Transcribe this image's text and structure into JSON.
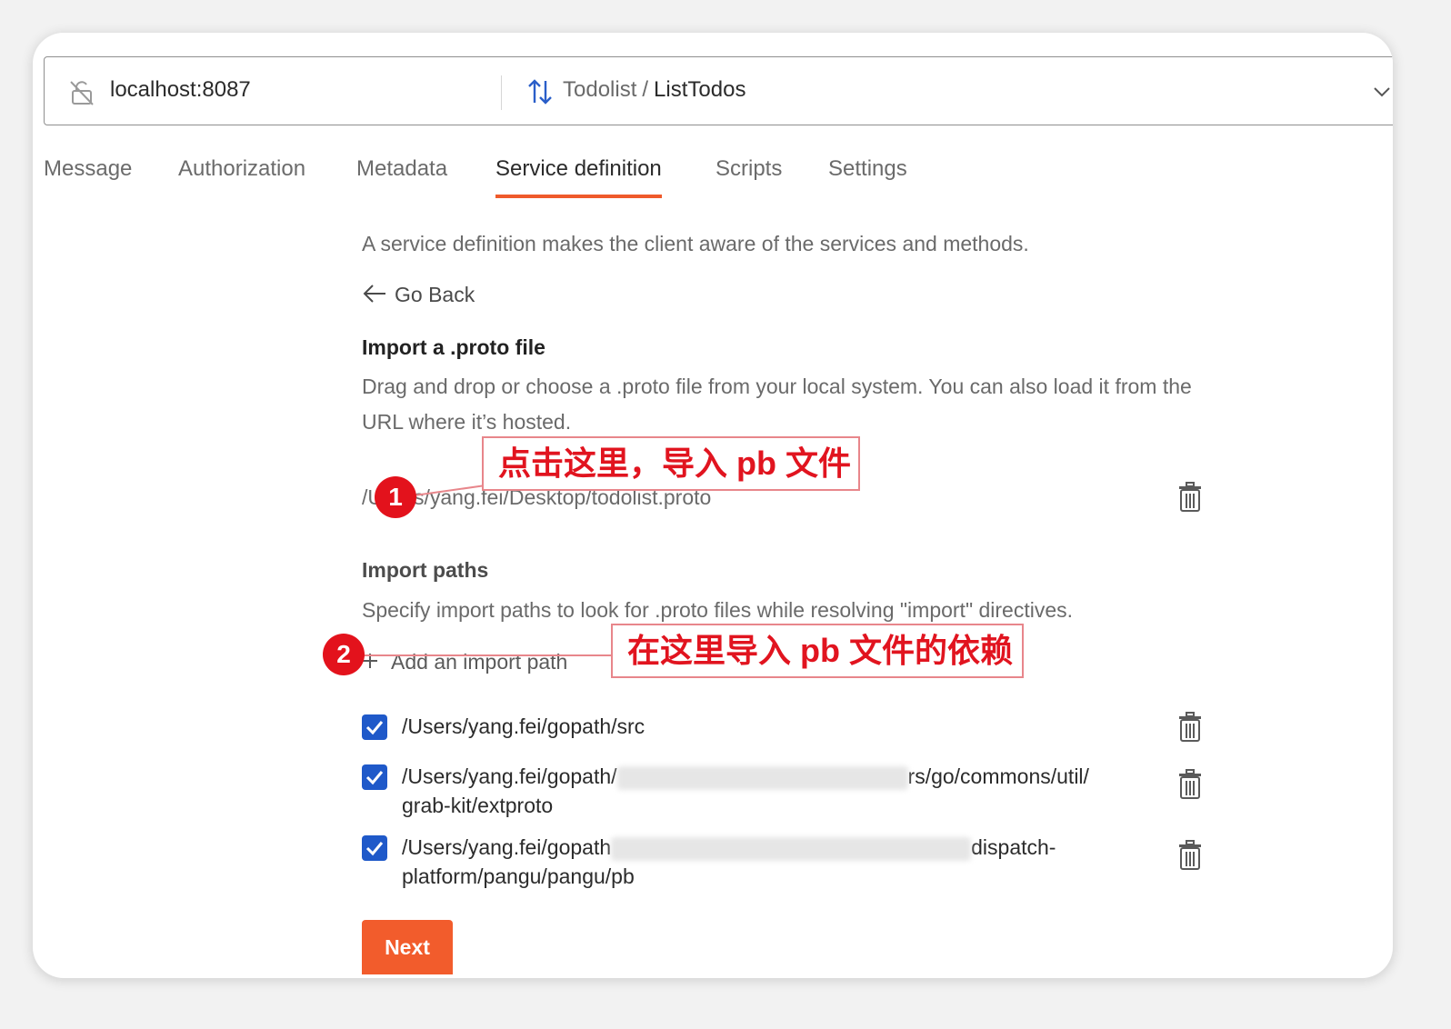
{
  "urlbar": {
    "host": "localhost:8087",
    "service": "Todolist",
    "separator": "/",
    "method": "ListTodos"
  },
  "tabs": [
    {
      "label": "Message"
    },
    {
      "label": "Authorization"
    },
    {
      "label": "Metadata"
    },
    {
      "label": "Service definition",
      "active": true
    },
    {
      "label": "Scripts"
    },
    {
      "label": "Settings"
    }
  ],
  "main": {
    "intro": "A service definition makes the client aware of the services and methods.",
    "go_back": "Go Back",
    "import_file": {
      "title": "Import a .proto file",
      "description": "Drag and drop or choose a .proto file from your local system. You can also load it from the URL where it’s hosted.",
      "path_visible": "s/yang.fei/Desktop/todolist.proto",
      "path_prefix": "/U"
    },
    "import_paths": {
      "title": "Import paths",
      "description": "Specify import paths to look for .proto files while resolving \"import\" directives.",
      "add_label": "Add an import path",
      "items": [
        {
          "checked": true,
          "text_a": "/Users/yang.fei/gopath/src",
          "text_b": ""
        },
        {
          "checked": true,
          "text_a": "/Users/yang.fei/gopath/",
          "text_b": "rs/go/commons/util/",
          "text_c": "grab-kit/extproto"
        },
        {
          "checked": true,
          "text_a": "/Users/yang.fei/gopath",
          "text_b": "dispatch-",
          "text_c": "platform/pangu/pangu/pb"
        }
      ]
    },
    "next_label": "Next"
  },
  "annotations": [
    {
      "number": "1",
      "text": "点击这里，导入 pb 文件"
    },
    {
      "number": "2",
      "text": "在这里导入 pb 文件的依赖"
    }
  ],
  "colors": {
    "accent": "#ef5a2b",
    "checkbox": "#1f59c9",
    "annotation": "#e3121c"
  }
}
